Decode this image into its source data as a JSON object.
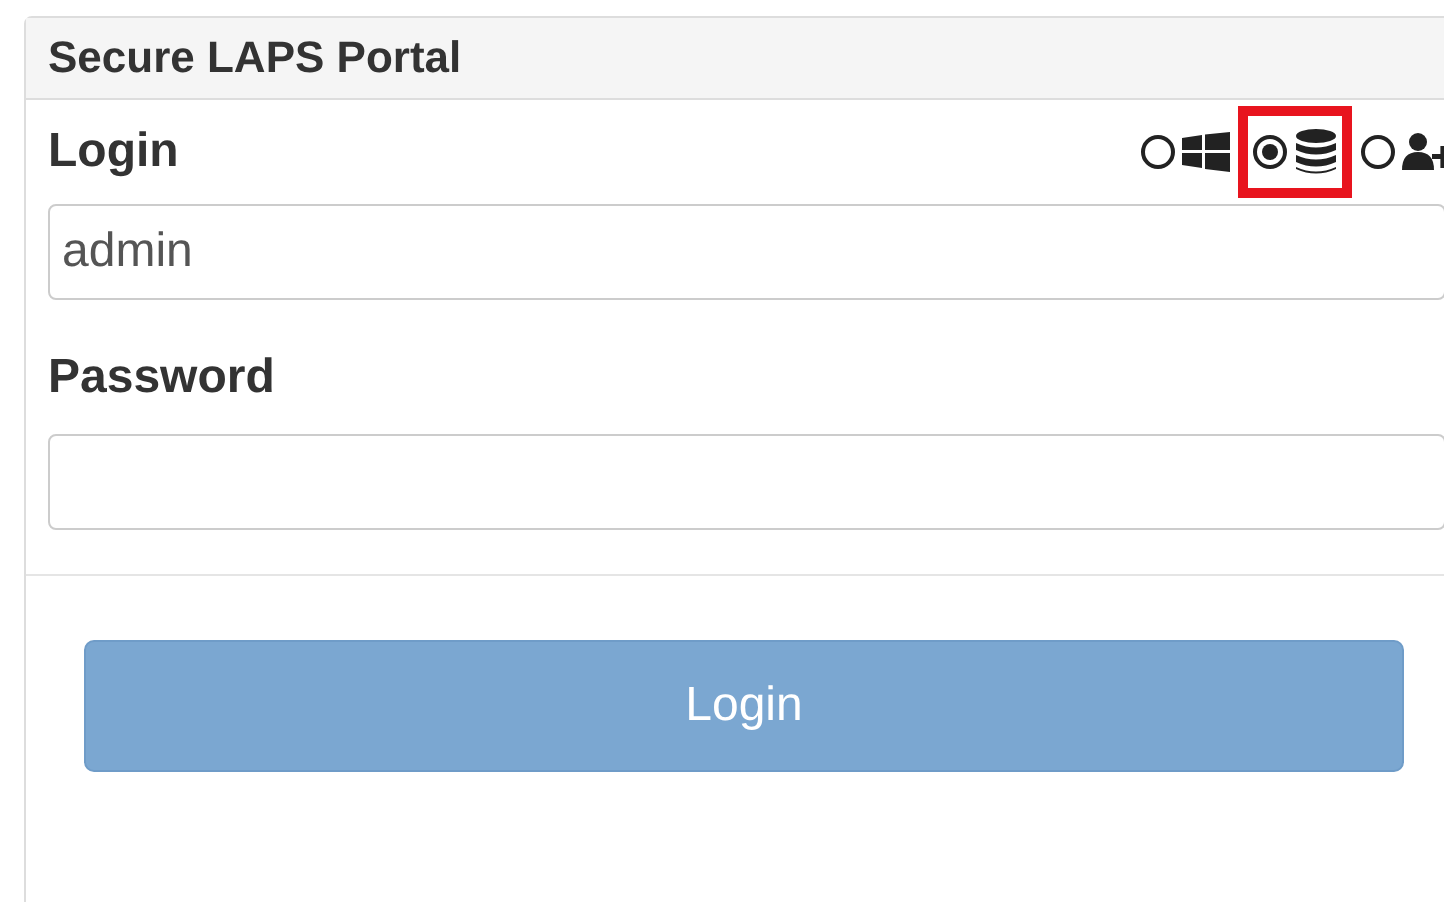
{
  "panel": {
    "title": "Secure LAPS Portal"
  },
  "login": {
    "label": "Login",
    "value": "admin"
  },
  "auth_options": [
    {
      "kind": "windows",
      "selected": false
    },
    {
      "kind": "database",
      "selected": true,
      "highlighted": true
    },
    {
      "kind": "user-add",
      "selected": false
    }
  ],
  "password": {
    "label": "Password"
  },
  "button": {
    "label": "Login"
  }
}
